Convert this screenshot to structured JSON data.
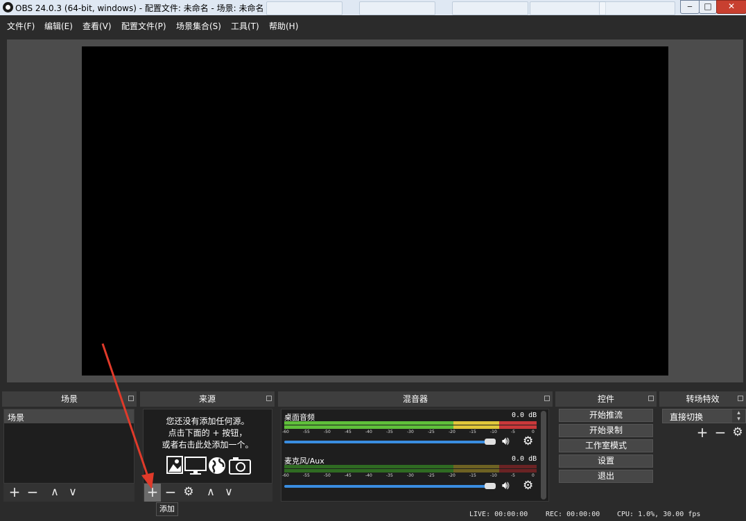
{
  "window": {
    "title": "OBS 24.0.3 (64-bit, windows) - 配置文件: 未命名 - 场景: 未命名"
  },
  "menu": {
    "items": [
      "文件(F)",
      "编辑(E)",
      "查看(V)",
      "配置文件(P)",
      "场景集合(S)",
      "工具(T)",
      "帮助(H)"
    ]
  },
  "docks": {
    "scenes": {
      "title": "场景",
      "items": [
        "场景"
      ]
    },
    "sources": {
      "title": "来源",
      "empty_line1": "您还没有添加任何源。",
      "empty_line2": "点击下面的 + 按钮，",
      "empty_line3": "或者右击此处添加一个。"
    },
    "mixer": {
      "title": "混音器",
      "tracks": [
        {
          "name": "桌面音频",
          "level": "0.0 dB"
        },
        {
          "name": "麦克风/Aux",
          "level": "0.0 dB"
        }
      ],
      "scale": [
        "-60",
        "-55",
        "-50",
        "-45",
        "-40",
        "-35",
        "-30",
        "-25",
        "-20",
        "-15",
        "-10",
        "-5",
        "0"
      ]
    },
    "controls": {
      "title": "控件",
      "buttons": [
        "开始推流",
        "开始录制",
        "工作室模式",
        "设置",
        "退出"
      ]
    },
    "transitions": {
      "title": "转场特效",
      "selected": "直接切换"
    }
  },
  "tooltip": "添加",
  "status": {
    "live": "LIVE: 00:00:00",
    "rec": "REC: 00:00:00",
    "cpu": "CPU: 1.0%, 30.00 fps"
  },
  "colors": {
    "meter_green": "#5fbf3a",
    "meter_yellow": "#e0c63a",
    "meter_red": "#c8383a",
    "slider_blue": "#3a8de0",
    "annotation_arrow": "#e03a2a"
  }
}
